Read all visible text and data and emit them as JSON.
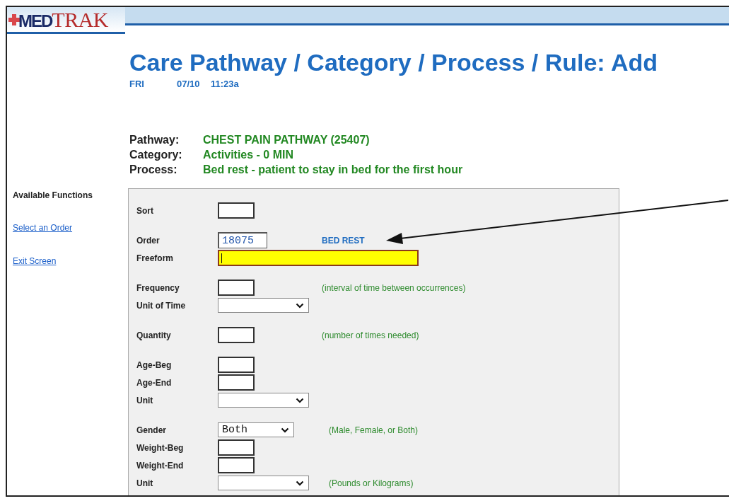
{
  "header": {
    "logo_prefix": "MED",
    "logo_suffix": "TRAK"
  },
  "title": "Care Pathway / Category / Process / Rule: Add",
  "datetime": {
    "day": "FRI",
    "date": "07/10",
    "time": "11:23a"
  },
  "context": [
    {
      "label": "Pathway:",
      "value": "CHEST PAIN PATHWAY (25407)"
    },
    {
      "label": "Category:",
      "value": "Activities - 0 MIN"
    },
    {
      "label": "Process:",
      "value": "Bed rest - patient to stay in bed for the first hour"
    }
  ],
  "sidebar": {
    "heading": "Available Functions",
    "links": [
      "Select an Order",
      "Exit Screen"
    ]
  },
  "form": {
    "groups": [
      [
        {
          "label": "Sort",
          "kind": "text",
          "focused": false
        }
      ],
      [
        {
          "label": "Order",
          "kind": "text",
          "value": "18075",
          "focused": false,
          "note": "BED REST"
        },
        {
          "label": "Freeform",
          "kind": "freeform",
          "focused": true
        }
      ],
      [
        {
          "label": "Frequency",
          "kind": "text",
          "focused": false,
          "hint": "(interval of time between occurrences)"
        },
        {
          "label": "Unit of Time",
          "kind": "select",
          "focused": false
        }
      ],
      [
        {
          "label": "Quantity",
          "kind": "text",
          "focused": false,
          "hint": "(number of times needed)"
        }
      ],
      [
        {
          "label": "Age-Beg",
          "kind": "text",
          "focused": false
        },
        {
          "label": "Age-End",
          "kind": "text",
          "focused": false
        },
        {
          "label": "Unit",
          "kind": "select",
          "focused": false
        }
      ],
      [
        {
          "label": "Gender",
          "kind": "select",
          "value": "Both",
          "focused": false,
          "hint": "(Male, Female, or Both)"
        },
        {
          "label": "Weight-Beg",
          "kind": "text",
          "focused": false
        },
        {
          "label": "Weight-End",
          "kind": "text",
          "focused": false
        },
        {
          "label": "Unit",
          "kind": "select",
          "focused": false,
          "hint": "(Pounds or Kilograms)"
        }
      ]
    ]
  }
}
